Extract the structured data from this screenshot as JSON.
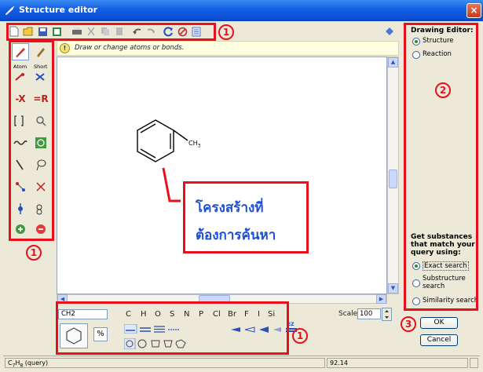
{
  "window": {
    "title": "Structure editor",
    "close_label": "×"
  },
  "hint": {
    "icon_glyph": "!",
    "text": "Draw or change atoms or bonds."
  },
  "left_tools": {
    "atom_label": "Atom",
    "short_label": "Short",
    "x_label": "-X",
    "r_label": "=R"
  },
  "structure": {
    "substituent": "CH",
    "substituent_sub": "3"
  },
  "callout": {
    "line1": "โครงสร้างที่",
    "line2": "ต้องการค้นหา",
    "color": "#1d4fd6"
  },
  "right_panel": {
    "drawing_editor_title": "Drawing Editor:",
    "modes": [
      {
        "label": "Structure",
        "selected": true
      },
      {
        "label": "Reaction",
        "selected": false
      }
    ],
    "search_title_1": "Get substances",
    "search_title_2": "that match your",
    "search_title_3": "query using:",
    "search_options": [
      {
        "label": "Exact search",
        "selected": true
      },
      {
        "label_1": "Substructure",
        "label_2": "search",
        "selected": false
      },
      {
        "label": "Similarity search",
        "selected": false
      }
    ],
    "ok_label": "OK",
    "cancel_label": "Cancel"
  },
  "bottom_panel": {
    "formula_input": "CH2",
    "atoms": [
      "C",
      "H",
      "O",
      "S",
      "N",
      "P",
      "Cl",
      "Br",
      "F",
      "I",
      "Si"
    ],
    "scale_label": "Scale",
    "scale_value": "100",
    "ez_label": "EZ"
  },
  "status": {
    "formula_main": "C",
    "formula_sub1": "7",
    "formula_h": "H",
    "formula_sub2": "8",
    "formula_suffix": " (query)",
    "mass": "92.14"
  },
  "annotations": {
    "num1": "1",
    "num2": "2",
    "num3": "3",
    "red": "#e8101d"
  }
}
